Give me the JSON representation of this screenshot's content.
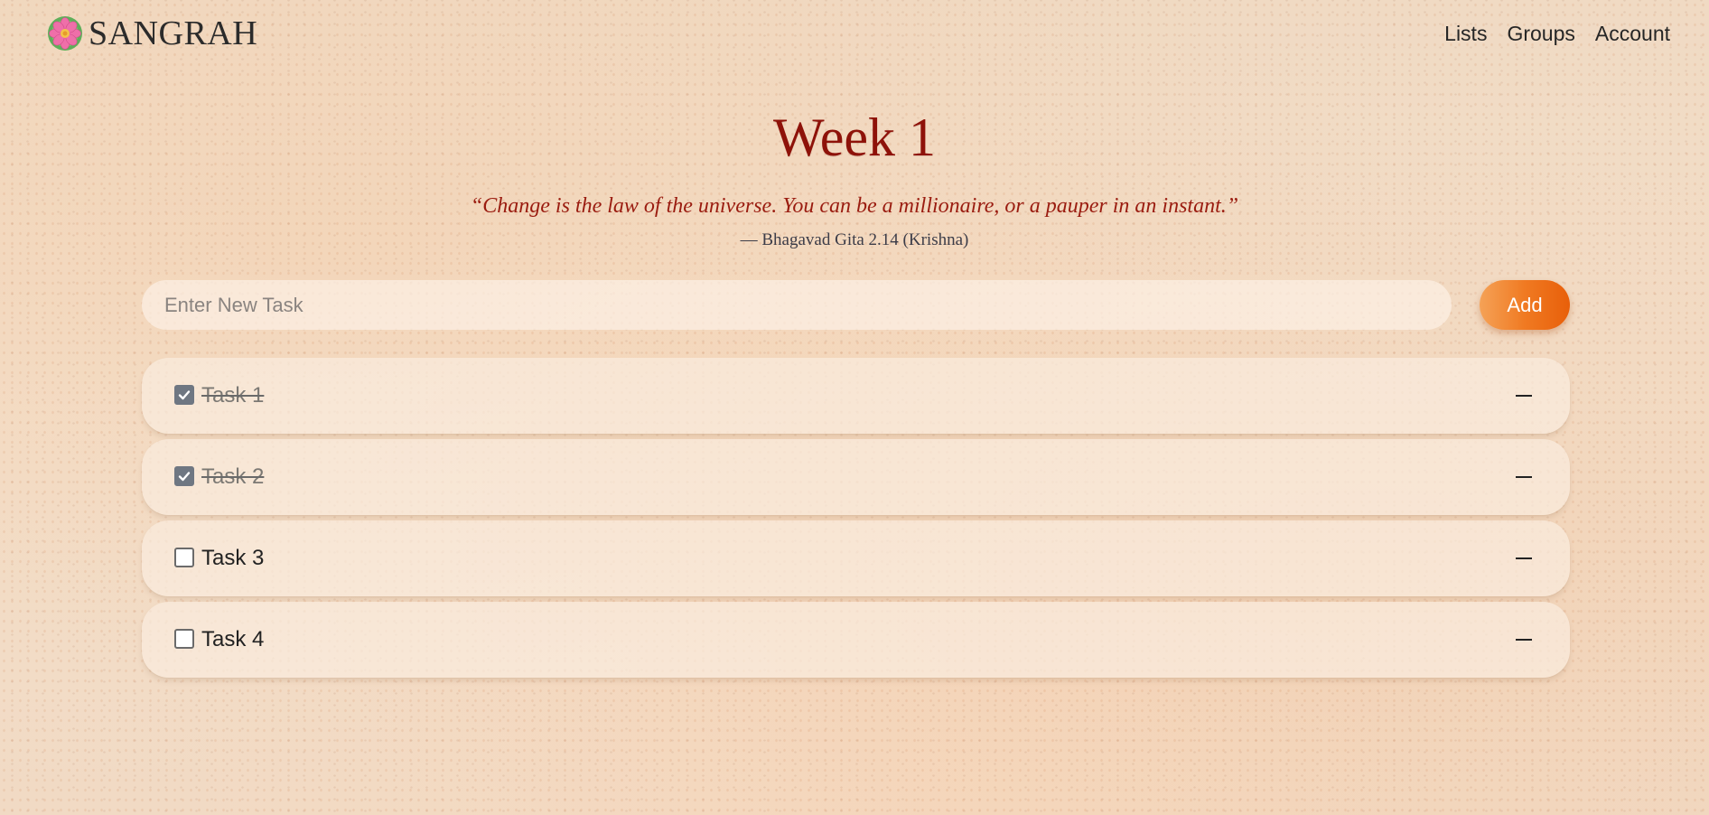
{
  "header": {
    "brand": "SANGRAH",
    "logo_icon": "lotus-flower-icon",
    "nav": [
      "Lists",
      "Groups",
      "Account"
    ]
  },
  "page": {
    "title": "Week 1",
    "quote": "“Change is the law of the universe. You can be a millionaire, or a pauper in an instant.”",
    "attribution": "— Bhagavad Gita 2.14 (Krishna)"
  },
  "new_task": {
    "placeholder": "Enter New Task",
    "value": "",
    "add_label": "Add"
  },
  "tasks": [
    {
      "label": "Task 1",
      "done": true
    },
    {
      "label": "Task 2",
      "done": true
    },
    {
      "label": "Task 3",
      "done": false
    },
    {
      "label": "Task 4",
      "done": false
    }
  ],
  "colors": {
    "title": "#8e1209",
    "quote": "#9a1c10",
    "accent": "#f07a22",
    "checkbox_checked": "#6f7782"
  }
}
